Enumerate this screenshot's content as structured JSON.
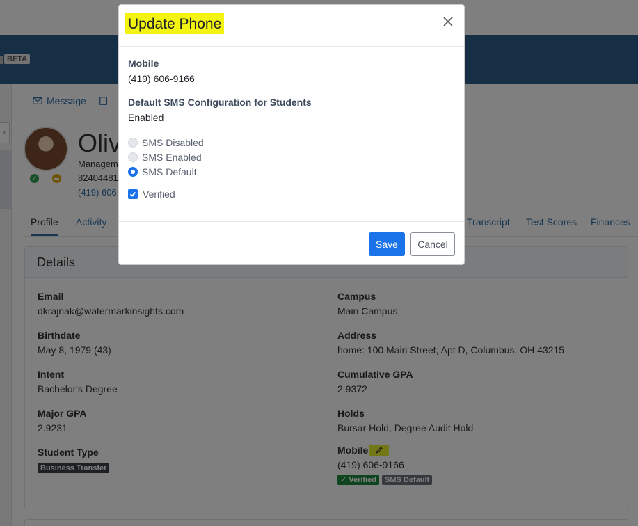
{
  "header": {
    "beta_label": "BETA"
  },
  "actions": {
    "message_label": "Message"
  },
  "student": {
    "name": "Oliv",
    "line1": "Managem",
    "line2": "82404481",
    "line3": "(419) 606"
  },
  "tabs": [
    {
      "label": "Profile"
    },
    {
      "label": "Activity"
    },
    {
      "label": "Transcript"
    },
    {
      "label": "Test Scores"
    },
    {
      "label": "Finances"
    }
  ],
  "details": {
    "title": "Details",
    "email_label": "Email",
    "email_value": "dkrajnak@watermarkinsights.com",
    "birthdate_label": "Birthdate",
    "birthdate_value": "May 8, 1979 (43)",
    "intent_label": "Intent",
    "intent_value": "Bachelor's Degree",
    "major_gpa_label": "Major GPA",
    "major_gpa_value": "2.9231",
    "student_type_label": "Student Type",
    "student_type_tag": "Business Transfer",
    "campus_label": "Campus",
    "campus_value": "Main Campus",
    "address_label": "Address",
    "address_value": "home: 100 Main Street, Apt D, Columbus, OH 43215",
    "cum_gpa_label": "Cumulative GPA",
    "cum_gpa_value": "2.9372",
    "holds_label": "Holds",
    "holds_value": "Bursar Hold, Degree Audit Hold",
    "mobile_label": "Mobile",
    "mobile_value": "(419) 606-9166",
    "verified_tag": "✓ Verified",
    "sms_tag": "SMS Default"
  },
  "modal": {
    "title": "Update Phone",
    "mobile_label": "Mobile",
    "mobile_value": "(419) 606-9166",
    "sms_config_label": "Default SMS Configuration for Students",
    "sms_config_value": "Enabled",
    "options": [
      "SMS Disabled",
      "SMS Enabled",
      "SMS Default"
    ],
    "selected_option": "SMS Default",
    "verified_label": "Verified",
    "verified_checked": true,
    "save_label": "Save",
    "cancel_label": "Cancel"
  },
  "colors": {
    "primary": "#1a73e8",
    "navbar": "#2f5f8a",
    "highlight": "#f4f411",
    "verified": "#1f8a3c"
  }
}
